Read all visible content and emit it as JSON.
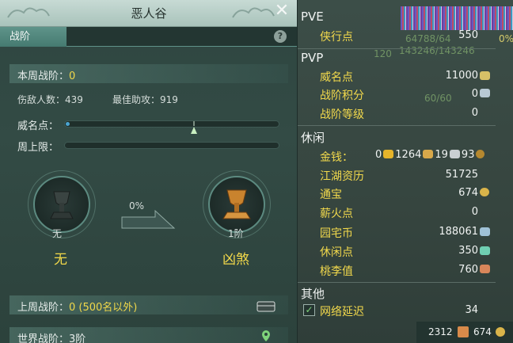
{
  "window": {
    "title": "恶人谷",
    "close": "✕"
  },
  "tabs": {
    "active": "战阶",
    "help": "?"
  },
  "weekly": {
    "label": "本周战阶：",
    "value": "0",
    "kills_label": "伤敌人数：",
    "kills": "439",
    "assist_label": "最佳助攻：",
    "assist": "919",
    "fame_label": "威名点：",
    "fame_progress": 0.02,
    "cap_label": "周上限：",
    "cap_progress": 0.0
  },
  "current_rank": {
    "level": "无",
    "title": "无"
  },
  "next_rank": {
    "level": "1阶",
    "title": "凶煞"
  },
  "progress_percent": "0%",
  "last_week": {
    "label": "上周战阶：",
    "value": "0 (500名以外)"
  },
  "world": {
    "label": "世界战阶：",
    "value": "3阶"
  },
  "stats": {
    "pve_header": "PVE",
    "xiaxing_label": "侠行点",
    "xiaxing_value": "550",
    "ghost_a": "64788/64",
    "ghost_b": "143246/143246",
    "ghost_c": "120",
    "ghost_d": "60/60",
    "ghost_e": "0%",
    "pvp_header": "PVP",
    "weiming_label": "威名点",
    "weiming_value": "11000",
    "zhanjie_score_label": "战阶积分",
    "zhanjie_score_value": "0",
    "zhanjie_level_label": "战阶等级",
    "zhanjie_level_value": "0",
    "leisure_header": "休闲",
    "money_label": "金钱：",
    "money_a": "0",
    "money_b": "1264",
    "money_c": "19",
    "money_d": "93",
    "jianghu_label": "江湖资历",
    "jianghu_value": "51725",
    "tongbao_label": "通宝",
    "tongbao_value": "674",
    "xinhuo_label": "薪火点",
    "xinhuo_value": "0",
    "yuanzhai_label": "园宅币",
    "yuanzhai_value": "188061",
    "xiuxian_label": "休闲点",
    "xiuxian_value": "350",
    "taoli_label": "桃李值",
    "taoli_value": "760",
    "other_header": "其他",
    "latency_label": "网络延迟",
    "latency_value": "34",
    "footer_a": "2312",
    "footer_b": "674"
  },
  "colors": {
    "accent_yellow": "#f1d84a",
    "panel": "#334b45",
    "tab_active": "#5f948a"
  }
}
